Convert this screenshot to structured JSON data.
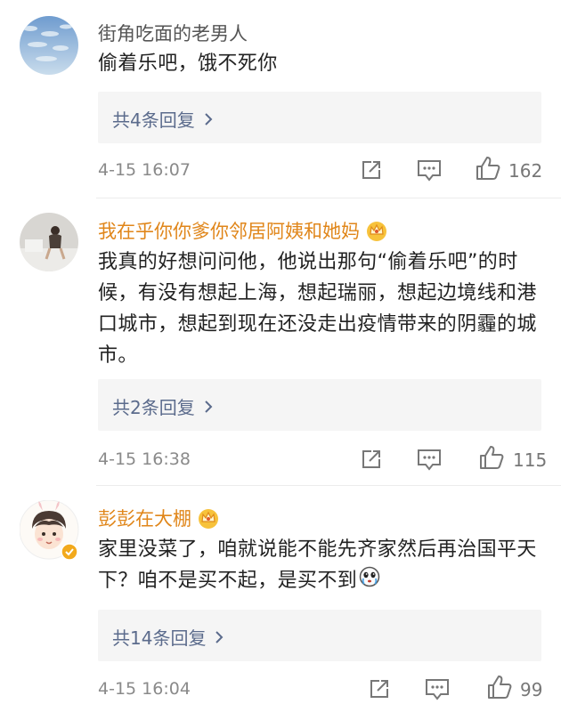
{
  "comments": [
    {
      "username": "街角吃面的老男人",
      "text": "偷着乐吧，饿不死你",
      "replies_label": "共4条回复",
      "timestamp": "4-15 16:07",
      "likes": "162",
      "name_color": "#555555"
    },
    {
      "username": "我在乎你你爹你邻居阿姨和她妈",
      "text": "我真的好想问问他，他说出那句“偷着乐吧”的时候，有没有想起上海，想起瑞丽，想起边境线和港口城市，想起到现在还没走出疫情带来的阴霾的城市。",
      "replies_label": "共2条回复",
      "timestamp": "4-15 16:38",
      "likes": "115",
      "name_color": "#e0861a"
    },
    {
      "username": "彭彭在大棚",
      "text": "家里没菜了，咱就说能不能先齐家然后再治国平天下？咱不是买不起，是买不到",
      "replies_label": "共14条回复",
      "timestamp": "4-15 16:04",
      "likes": "99",
      "name_color": "#e0861a"
    }
  ],
  "icons": {
    "share": "share-icon",
    "comment": "comment-icon",
    "like": "thumbs-up-icon",
    "reply_chevron": "chevron-right-icon",
    "crown": "crown-badge-icon",
    "verified": "verified-badge-icon",
    "emoji": "crying-face-emoji-icon"
  },
  "colors": {
    "link_blue": "#5b6b8c",
    "vip_gold": "#e0861a",
    "meta_gray": "#8a8a8a"
  }
}
